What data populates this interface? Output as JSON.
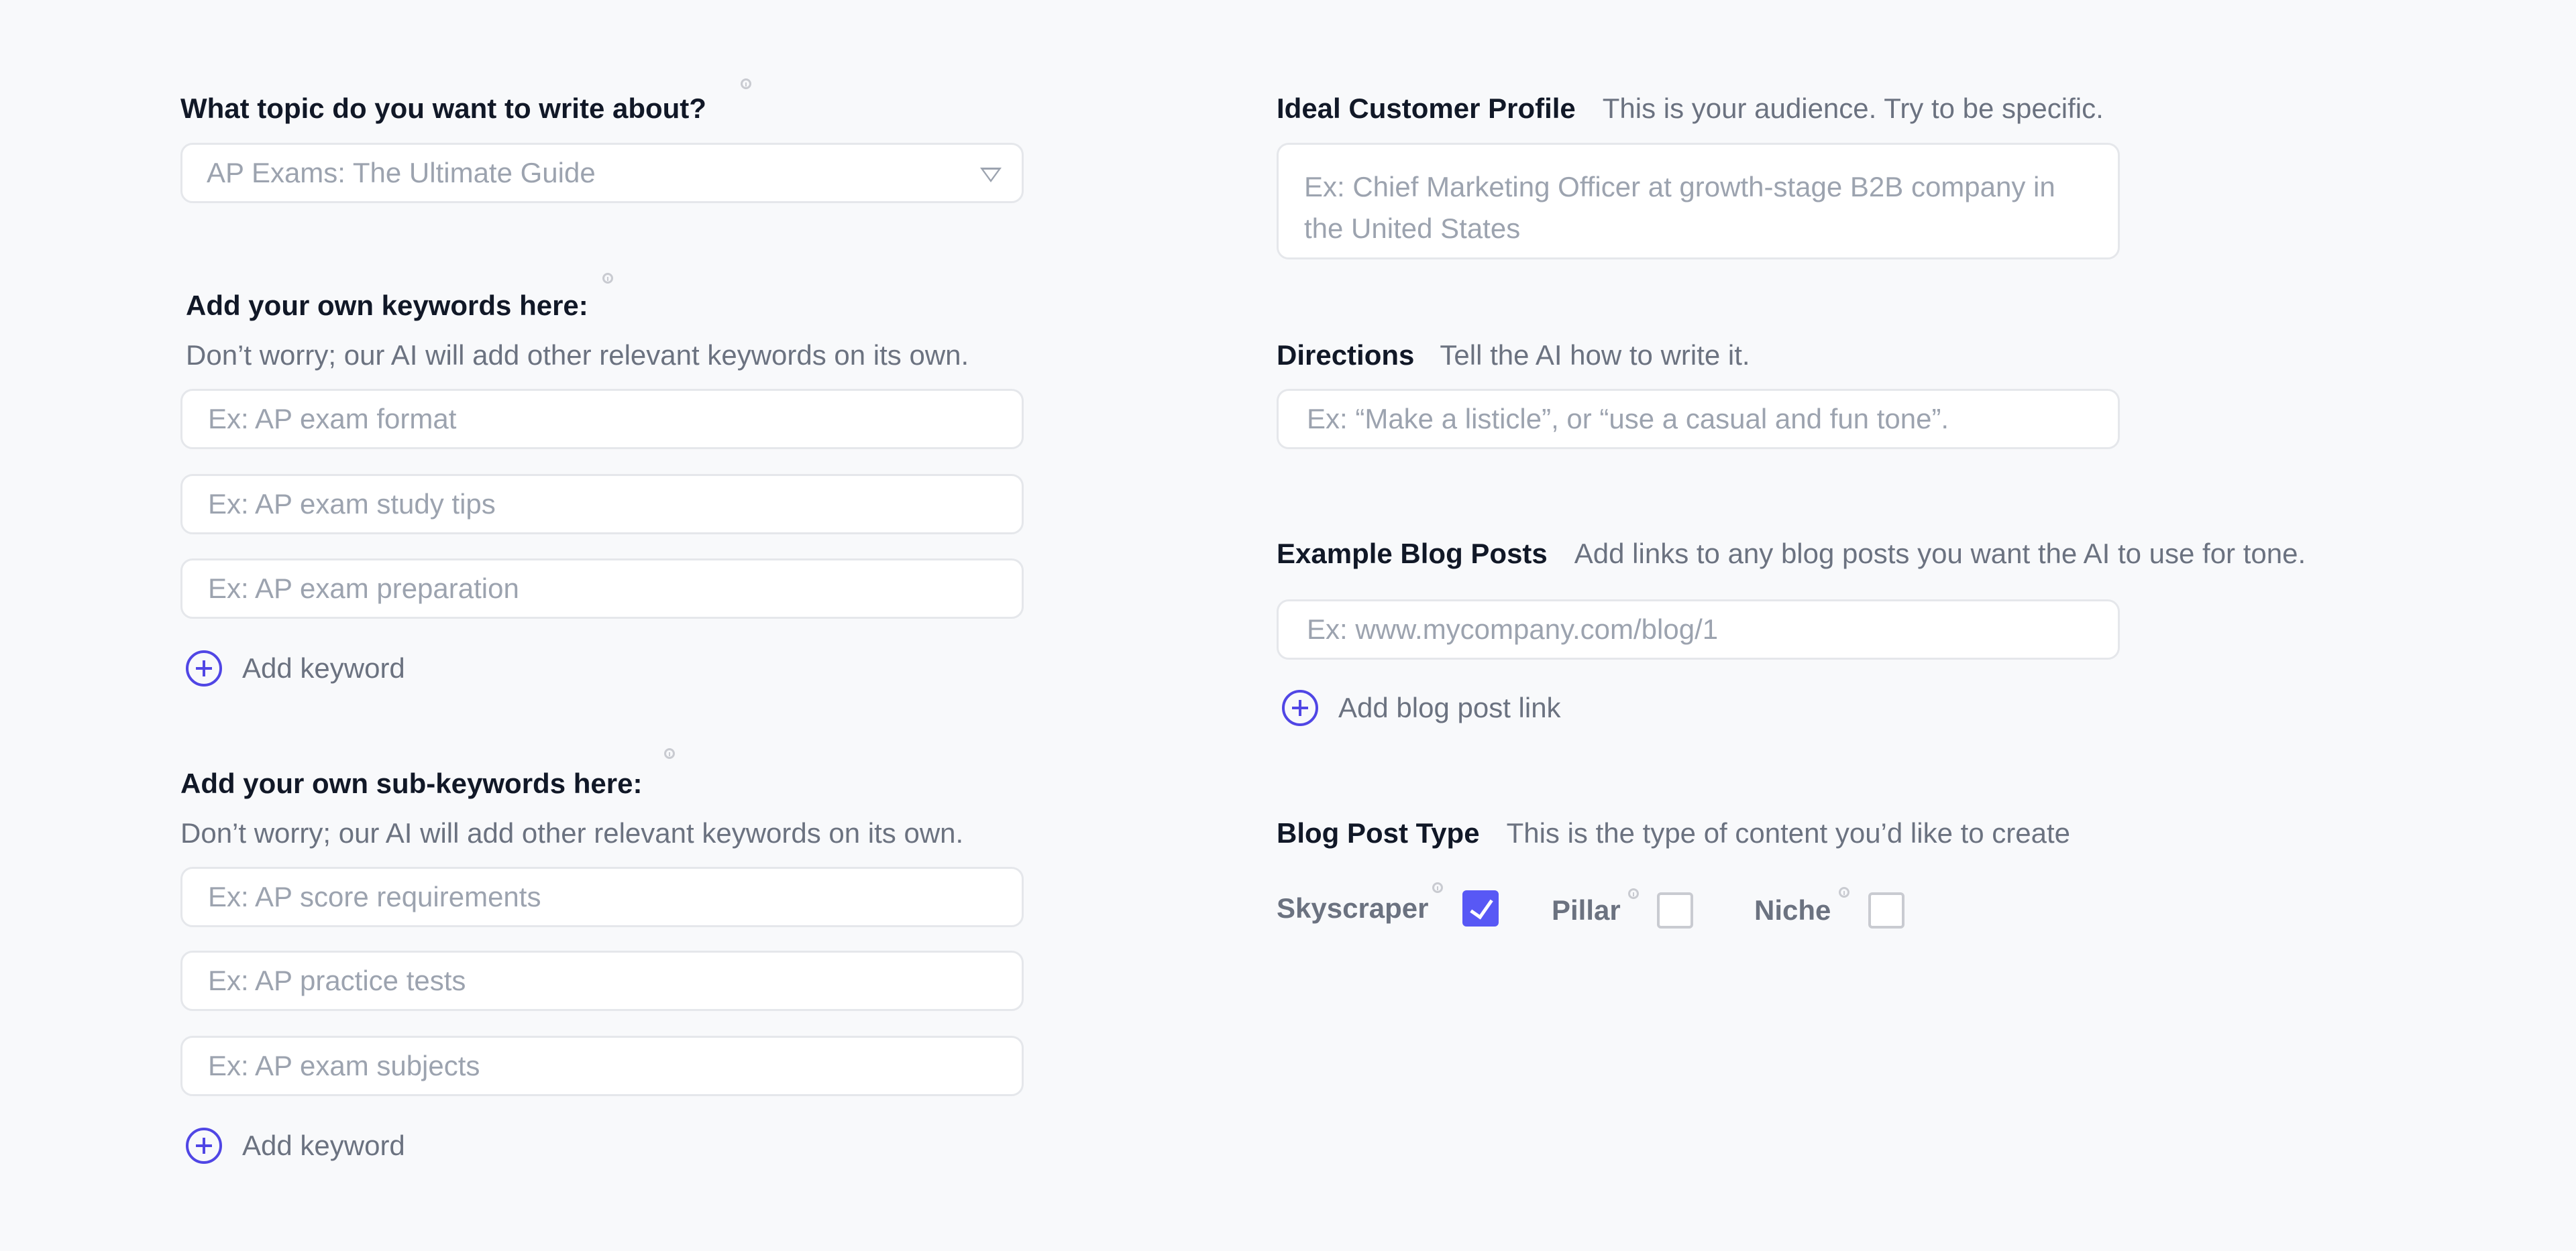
{
  "left": {
    "topic": {
      "label": "What topic do you want to write about?",
      "selected": "AP Exams: The Ultimate Guide"
    },
    "keywords": {
      "label": "Add your own keywords here:",
      "hint": "Don’t worry; our AI will add other relevant keywords on its own.",
      "placeholders": [
        "Ex: AP exam format",
        "Ex: AP exam study tips",
        "Ex: AP exam preparation"
      ],
      "add_label": "Add keyword"
    },
    "subkeywords": {
      "label": "Add your own sub-keywords here:",
      "hint": "Don’t worry; our AI will add other relevant keywords on its own.",
      "placeholders": [
        "Ex: AP score requirements",
        "Ex: AP practice tests",
        "Ex: AP exam subjects"
      ],
      "add_label": "Add keyword"
    }
  },
  "right": {
    "icp": {
      "label": "Ideal Customer Profile",
      "hint": "This is your audience. Try to be specific.",
      "placeholder": "Ex: Chief Marketing Officer at growth-stage B2B company in the United States"
    },
    "directions": {
      "label": "Directions",
      "hint": "Tell the AI how to write it.",
      "placeholder": "Ex: “Make a listicle”, or “use a casual and fun tone”."
    },
    "examples": {
      "label": "Example Blog Posts",
      "hint": "Add links to any blog posts you want the AI to use for tone.",
      "placeholder": "Ex: www.mycompany.com/blog/1",
      "add_label": "Add blog post link"
    },
    "post_type": {
      "label": "Blog Post Type",
      "hint": "This is the type of content you’d like to create",
      "options": [
        {
          "label": "Skyscraper",
          "checked": true
        },
        {
          "label": "Pillar",
          "checked": false
        },
        {
          "label": "Niche",
          "checked": false
        }
      ]
    }
  },
  "colors": {
    "accent": "#5046e5",
    "checkbox_checked": "#5858f5",
    "background": "#f8f9fb"
  }
}
